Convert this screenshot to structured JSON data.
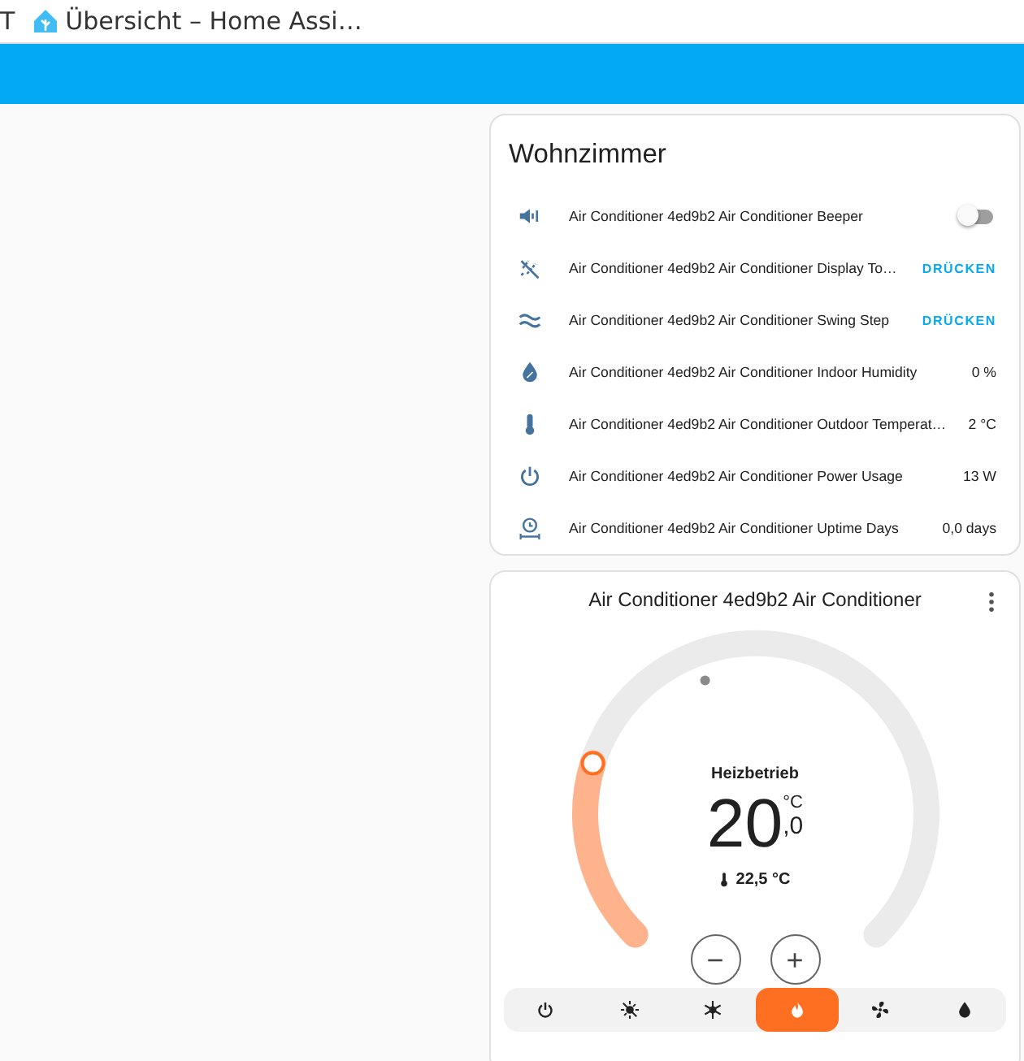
{
  "browser_tab": {
    "left_text": "T",
    "title": "Übersicht – Home Assi…"
  },
  "entities_card": {
    "title": "Wohnzimmer",
    "rows": [
      {
        "name": "Air Conditioner 4ed9b2 Air Conditioner Beeper",
        "kind": "toggle",
        "on": false
      },
      {
        "name": "Air Conditioner 4ed9b2 Air Conditioner Display To…",
        "kind": "button",
        "action": "DRÜCKEN"
      },
      {
        "name": "Air Conditioner 4ed9b2 Air Conditioner Swing Step",
        "kind": "button",
        "action": "DRÜCKEN"
      },
      {
        "name": "Air Conditioner 4ed9b2 Air Conditioner Indoor Humidity",
        "kind": "value",
        "value": "0 %"
      },
      {
        "name": "Air Conditioner 4ed9b2 Air Conditioner Outdoor Temperat…",
        "kind": "value",
        "value": "2 °C"
      },
      {
        "name": "Air Conditioner 4ed9b2 Air Conditioner Power Usage",
        "kind": "value",
        "value": "13 W"
      },
      {
        "name": "Air Conditioner 4ed9b2 Air Conditioner Uptime Days",
        "kind": "value",
        "value": "0,0 days"
      }
    ]
  },
  "thermostat_card": {
    "title": "Air Conditioner 4ed9b2 Air Conditioner",
    "mode_label": "Heizbetrieb",
    "target": {
      "integer": "20",
      "decimal": ",0",
      "unit": "°C"
    },
    "current": {
      "text": "22,5 °C"
    },
    "minus": "−",
    "plus": "+",
    "modes": [
      {
        "kind": "off",
        "selected": false
      },
      {
        "kind": "auto",
        "selected": false
      },
      {
        "kind": "cool",
        "selected": false
      },
      {
        "kind": "heat",
        "selected": true
      },
      {
        "kind": "fan",
        "selected": false
      },
      {
        "kind": "dry",
        "selected": false
      }
    ]
  }
}
